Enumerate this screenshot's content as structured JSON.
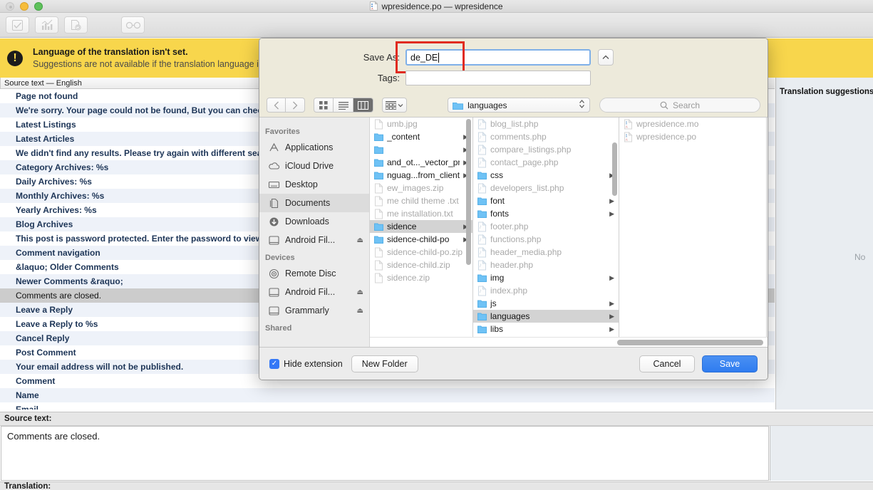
{
  "window": {
    "title": "wpresidence.po — wpresidence",
    "title_icon": "po-file-icon",
    "traffic_lights": [
      "close",
      "minimize",
      "zoom"
    ]
  },
  "toolbar": {
    "buttons": [
      {
        "name": "validate-button",
        "icon": "checkbox-icon"
      },
      {
        "name": "statistics-button",
        "icon": "bar-chart-icon"
      },
      {
        "name": "update-from-code-button",
        "icon": "document-refresh-icon"
      },
      {
        "name": "pre-translate-button",
        "icon": "glasses-icon"
      }
    ]
  },
  "banner": {
    "icon": "warning-exclamation-icon",
    "title": "Language of the translation isn't set.",
    "subtitle": "Suggestions are not available if the translation language is n"
  },
  "list": {
    "header": "Source text — English",
    "rows": [
      "Page not found",
      "We're sorry. Your page could not be found, But you can check",
      "Latest Listings",
      "Latest Articles",
      "We didn't find any results. Please try again with different sear",
      "Category Archives: %s",
      "Daily Archives: %s",
      "Monthly Archives: %s",
      "Yearly Archives: %s",
      "Blog Archives",
      "This post is password protected. Enter the password to view a",
      "Comment navigation",
      "&laquo; Older Comments",
      "Newer Comments &raquo;",
      "Comments are closed.",
      "Leave a Reply",
      "Leave a Reply to %s",
      "Cancel Reply",
      "Post Comment",
      "Your email address will not be published.",
      "Comment",
      "Name",
      "Email"
    ],
    "selected_index": 14
  },
  "suggestions": {
    "title": "Translation suggestions",
    "empty_text": "No"
  },
  "editor": {
    "source_label": "Source text:",
    "source_value": "Comments are closed.",
    "translation_label": "Translation:"
  },
  "dialog": {
    "save_as_label": "Save As:",
    "filename_value": "de_DE",
    "tags_label": "Tags:",
    "tags_value": "",
    "disclosure_icon": "chevron-up-icon",
    "nav": {
      "back_icon": "chevron-left-icon",
      "forward_icon": "chevron-right-icon"
    },
    "view_modes": [
      {
        "name": "icon-view-button",
        "icon": "grid-icon",
        "active": false
      },
      {
        "name": "list-view-button",
        "icon": "list-icon",
        "active": false
      },
      {
        "name": "column-view-button",
        "icon": "columns-icon",
        "active": true
      }
    ],
    "arrange_button": {
      "name": "arrange-by-button",
      "icon": "arrange-icon"
    },
    "path_popup": {
      "icon": "folder-icon",
      "label": "languages",
      "stepper_icon": "updown-chevron-icon"
    },
    "search": {
      "icon": "search-icon",
      "placeholder": "Search"
    },
    "sidebar": {
      "groups": [
        {
          "title": "Favorites",
          "items": [
            {
              "label": "Applications",
              "icon": "applications-icon",
              "eject": false,
              "selected": false
            },
            {
              "label": "iCloud Drive",
              "icon": "cloud-icon",
              "eject": false,
              "selected": false
            },
            {
              "label": "Desktop",
              "icon": "desktop-icon",
              "eject": false,
              "selected": false
            },
            {
              "label": "Documents",
              "icon": "documents-icon",
              "eject": false,
              "selected": true
            },
            {
              "label": "Downloads",
              "icon": "downloads-icon",
              "eject": false,
              "selected": false
            },
            {
              "label": "Android Fil...",
              "icon": "drive-icon",
              "eject": true,
              "selected": false
            }
          ]
        },
        {
          "title": "Devices",
          "items": [
            {
              "label": "Remote Disc",
              "icon": "disc-icon",
              "eject": false,
              "selected": false
            },
            {
              "label": "Android Fil...",
              "icon": "drive-icon",
              "eject": true,
              "selected": false
            },
            {
              "label": "Grammarly",
              "icon": "drive-icon",
              "eject": true,
              "selected": false
            }
          ]
        },
        {
          "title": "Shared",
          "items": []
        }
      ]
    },
    "columns": [
      {
        "name": "file-column-1",
        "items": [
          {
            "label": "umb.jpg",
            "type": "file",
            "arrow": false,
            "selected": false
          },
          {
            "label": "_content",
            "type": "folder",
            "arrow": true,
            "selected": false
          },
          {
            "label": "",
            "type": "folder",
            "arrow": true,
            "selected": false
          },
          {
            "label": "and_ot..._vector_png",
            "type": "folder",
            "arrow": true,
            "selected": false
          },
          {
            "label": "nguag...from_clients",
            "type": "folder",
            "arrow": true,
            "selected": false
          },
          {
            "label": "ew_images.zip",
            "type": "file",
            "arrow": false,
            "selected": false
          },
          {
            "label": "me child theme .txt",
            "type": "file",
            "arrow": false,
            "selected": false
          },
          {
            "label": "me installation.txt",
            "type": "file",
            "arrow": false,
            "selected": false
          },
          {
            "label": "sidence",
            "type": "folder",
            "arrow": true,
            "selected": true
          },
          {
            "label": "sidence-child-po",
            "type": "folder",
            "arrow": true,
            "selected": false
          },
          {
            "label": "sidence-child-po.zip",
            "type": "file",
            "arrow": false,
            "selected": false
          },
          {
            "label": "sidence-child.zip",
            "type": "file",
            "arrow": false,
            "selected": false
          },
          {
            "label": "sidence.zip",
            "type": "file",
            "arrow": false,
            "selected": false
          }
        ]
      },
      {
        "name": "file-column-2",
        "items": [
          {
            "label": "blog_list.php",
            "type": "php",
            "arrow": false,
            "selected": false
          },
          {
            "label": "comments.php",
            "type": "php",
            "arrow": false,
            "selected": false
          },
          {
            "label": "compare_listings.php",
            "type": "php",
            "arrow": false,
            "selected": false
          },
          {
            "label": "contact_page.php",
            "type": "php",
            "arrow": false,
            "selected": false
          },
          {
            "label": "css",
            "type": "folder",
            "arrow": true,
            "selected": false
          },
          {
            "label": "developers_list.php",
            "type": "php",
            "arrow": false,
            "selected": false
          },
          {
            "label": "font",
            "type": "folder",
            "arrow": true,
            "selected": false
          },
          {
            "label": "fonts",
            "type": "folder",
            "arrow": true,
            "selected": false
          },
          {
            "label": "footer.php",
            "type": "php",
            "arrow": false,
            "selected": false
          },
          {
            "label": "functions.php",
            "type": "php",
            "arrow": false,
            "selected": false
          },
          {
            "label": "header_media.php",
            "type": "php",
            "arrow": false,
            "selected": false
          },
          {
            "label": "header.php",
            "type": "php",
            "arrow": false,
            "selected": false
          },
          {
            "label": "img",
            "type": "folder",
            "arrow": true,
            "selected": false
          },
          {
            "label": "index.php",
            "type": "php",
            "arrow": false,
            "selected": false
          },
          {
            "label": "js",
            "type": "folder",
            "arrow": true,
            "selected": false
          },
          {
            "label": "languages",
            "type": "folder",
            "arrow": true,
            "selected": true
          },
          {
            "label": "libs",
            "type": "folder",
            "arrow": true,
            "selected": false
          }
        ]
      },
      {
        "name": "file-column-3",
        "items": [
          {
            "label": "wpresidence.mo",
            "type": "po",
            "arrow": false,
            "selected": false
          },
          {
            "label": "wpresidence.po",
            "type": "po",
            "arrow": false,
            "selected": false
          }
        ]
      }
    ],
    "footer": {
      "hide_extension_label": "Hide extension",
      "hide_extension_checked": true,
      "new_folder_label": "New Folder",
      "cancel_label": "Cancel",
      "save_label": "Save"
    }
  },
  "colors": {
    "banner_yellow": "#f8d64c",
    "accent_blue": "#3478f6",
    "highlight_red": "#e02b20",
    "list_stripe": "#eef2f9",
    "list_text": "#1d3557"
  }
}
